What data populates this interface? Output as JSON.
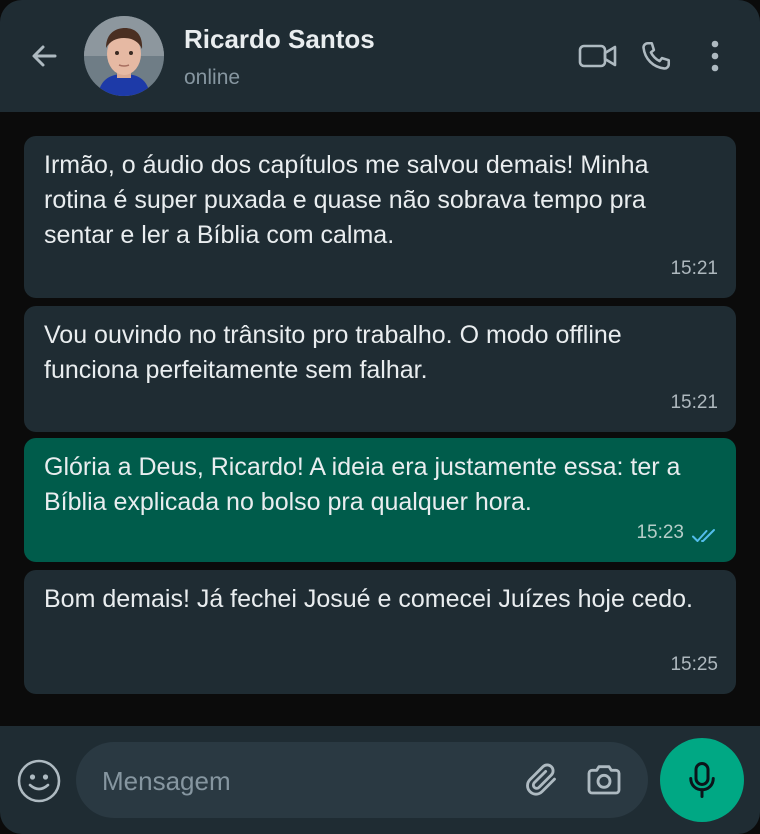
{
  "header": {
    "contact_name": "Ricardo Santos",
    "status": "online",
    "icons": [
      "back-arrow-icon",
      "video-call-icon",
      "phone-call-icon",
      "more-vertical-icon"
    ]
  },
  "messages": [
    {
      "direction": "incoming",
      "text": "Irmão, o áudio dos capítulos me salvou demais! Minha rotina é super puxada e quase não sobrava tempo pra sentar e ler a Bíblia com calma.",
      "time": "15:21"
    },
    {
      "direction": "incoming",
      "text": "Vou ouvindo no trânsito pro trabalho. O modo offline funciona perfeitamente sem falhar.",
      "time": "15:21"
    },
    {
      "direction": "outgoing",
      "text": "Glória a Deus, Ricardo! A ideia era justamente essa: ter a Bíblia explicada no bolso pra qualquer hora.",
      "time": "15:23",
      "read": true
    },
    {
      "direction": "incoming",
      "text": "Bom demais! Já fechei Josué e comecei Juízes hoje cedo.",
      "time": "15:25"
    }
  ],
  "composer": {
    "placeholder": "Mensagem",
    "value": "",
    "icons": [
      "emoji-icon",
      "attach-icon",
      "camera-icon",
      "mic-icon"
    ]
  },
  "colors": {
    "header_bg": "#1f2c33",
    "chat_bg": "#0b0b0b",
    "incoming_bubble": "#1f2c33",
    "outgoing_bubble": "#005c4b",
    "accent": "#00a884",
    "read_ticks": "#53bdeb"
  }
}
